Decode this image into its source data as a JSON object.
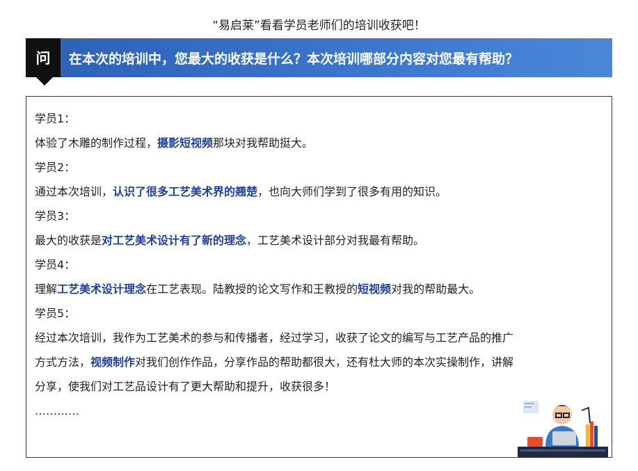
{
  "top_caption": "“易启莱”看看学员老师们的培训收获吧！",
  "question": {
    "tag": "问",
    "text": "在本次的培训中，您最大的收获是什么？本次培训哪部分内容对您最有帮助？"
  },
  "answers": {
    "s1_label": "学员1：",
    "s1_a": "体验了木雕的制作过程，",
    "s1_hl": "摄影短视频",
    "s1_b": "那块对我帮助挺大。",
    "s2_label": "学员2：",
    "s2_a": "通过本次培训，",
    "s2_hl": "认识了很多工艺美术界的翘楚",
    "s2_b": "，也向大师们学到了很多有用的知识。",
    "s3_label": "学员3：",
    "s3_a": "最大的收获是",
    "s3_hl": "对工艺美术设计有了新的理念",
    "s3_b": "，工艺美术设计部分对我最有帮助。",
    "s4_label": "学员4：",
    "s4_a": "理解",
    "s4_hl1": "工艺美术设计理念",
    "s4_b": "在工艺表现。陆教授的论文写作和王教授的",
    "s4_hl2": "短视频",
    "s4_c": "对我的帮助最大。",
    "s5_label": "学员5：",
    "s5_line1": "经过本次培训，我作为工艺美术的参与和传播者，经过学习，收获了论文的编写与工艺产品的推广",
    "s5_line2_a": "方式方法，",
    "s5_line2_hl": "视频制作",
    "s5_line2_b": "对我们创作作品，分享作品的帮助都很大，还有杜大师的本次实操制作，讲解",
    "s5_line3": "分享，使我们对工艺品设计有了更大帮助和提升，收获很多！",
    "ellipsis": "…………"
  },
  "colors": {
    "question_bar": "#3070c8",
    "tag_bg": "#111111",
    "highlight": "#1f3fa0"
  }
}
